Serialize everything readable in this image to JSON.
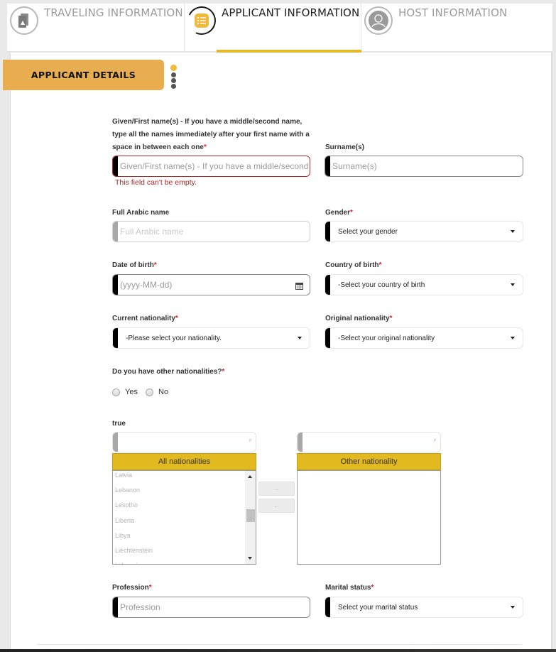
{
  "tabs": [
    {
      "label": "TRAVELING INFORMATION",
      "icon": "passport-icon",
      "active": false
    },
    {
      "label": "APPLICANT INFORMATION",
      "icon": "list-icon",
      "active": true
    },
    {
      "label": "HOST INFORMATION",
      "icon": "user-icon",
      "active": false
    }
  ],
  "section": {
    "title": "APPLICANT DETAILS"
  },
  "colors": {
    "accent": "#e7ad4e",
    "tab_underline": "#e2b92a",
    "list_header": "#e2b91e",
    "error": "#a32a2a"
  },
  "form": {
    "given_name": {
      "label": "Given/First name(s) - If you have a middle/second name, type all the names immediately after your first name with a space in between each one",
      "required": "*",
      "placeholder": "Given/First name(s) - If you have a middle/second name",
      "error": "This field can't be empty."
    },
    "surname": {
      "label": "Surname(s)",
      "placeholder": "Surname(s)"
    },
    "arabic_name": {
      "label": "Full Arabic name",
      "placeholder": "Full Arabic name"
    },
    "gender": {
      "label": "Gender",
      "required": "*",
      "value": "Select your gender"
    },
    "dob": {
      "label": "Date of birth",
      "required": "*",
      "placeholder": "(yyyy-MM-dd)"
    },
    "country_of_birth": {
      "label": "Country of birth",
      "required": "*",
      "value": "-Select your country of birth"
    },
    "current_nationality": {
      "label": "Current nationality",
      "required": "*",
      "value": "-Please select your nationality."
    },
    "original_nationality": {
      "label": "Original nationality",
      "required": "*",
      "value": "-Select your original nationality"
    },
    "other_nationalities": {
      "label": "Do you have other nationalities?",
      "required": "*",
      "options": [
        "Yes",
        "No"
      ]
    },
    "dual_list": {
      "label": "true",
      "left_header": "All nationalities",
      "right_header": "Other nationality",
      "left_items": [
        "Latvia",
        "Lebanon",
        "Lesotho",
        "Liberia",
        "Libya",
        "Liechtenstein",
        "Lithuania"
      ],
      "right_items": [],
      "move_right": "→",
      "move_left": "←"
    },
    "profession": {
      "label": "Profession",
      "required": "*",
      "placeholder": "Profession"
    },
    "marital_status": {
      "label": "Marital status",
      "required": "*",
      "value": "Select your marital status"
    }
  }
}
